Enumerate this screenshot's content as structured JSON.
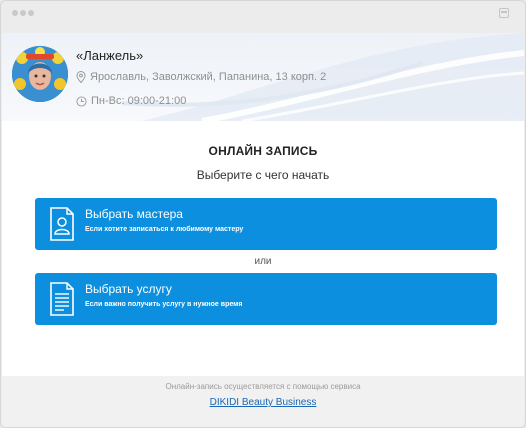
{
  "salon": {
    "name": "«Ланжель»",
    "address": "Ярославль, Заволжский, Папанина, 13 корп. 2",
    "hours": "Пн-Вс: 09:00-21:00"
  },
  "booking": {
    "title": "ОНЛАЙН ЗАПИСЬ",
    "subtitle": "Выберите с чего начать",
    "or_label": "или",
    "choices": [
      {
        "title": "Выбрать мастера",
        "description": "Если хотите записаться к любимому мастеру",
        "icon": "person-document-icon"
      },
      {
        "title": "Выбрать услугу",
        "description": "Если важно получить услугу в нужное время",
        "icon": "document-list-icon"
      }
    ]
  },
  "footer": {
    "note": "Онлайн-запись осуществляется с помощью сервиса",
    "link": "DIKIDI Beauty Business"
  },
  "colors": {
    "accent": "#0b8fde",
    "link": "#1a66b5",
    "footer_bg": "#f1f1f1"
  }
}
